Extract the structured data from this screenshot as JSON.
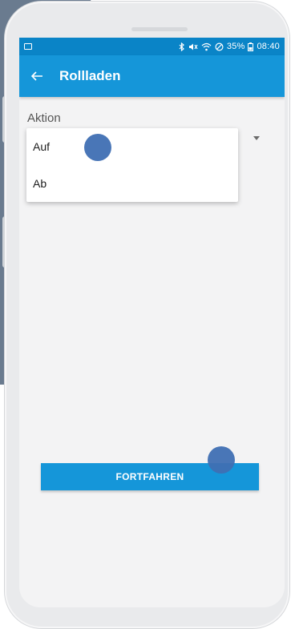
{
  "status_bar": {
    "battery_percent": "35%",
    "time": "08:40",
    "icons": [
      "image-icon",
      "bluetooth-icon",
      "mute-icon",
      "wifi-icon",
      "dnd-icon",
      "battery-icon"
    ]
  },
  "app_bar": {
    "back_icon": "arrow-left-icon",
    "title": "Rollladen"
  },
  "form": {
    "field_label": "Aktion",
    "dropdown_icon": "caret-down-icon",
    "options": [
      "Auf",
      "Ab"
    ]
  },
  "actions": {
    "continue_label": "FORTFAHREN"
  },
  "colors": {
    "status_bar": "#0a84c7",
    "primary": "#1596d9",
    "touch_indicator": "#3f6fb3"
  }
}
